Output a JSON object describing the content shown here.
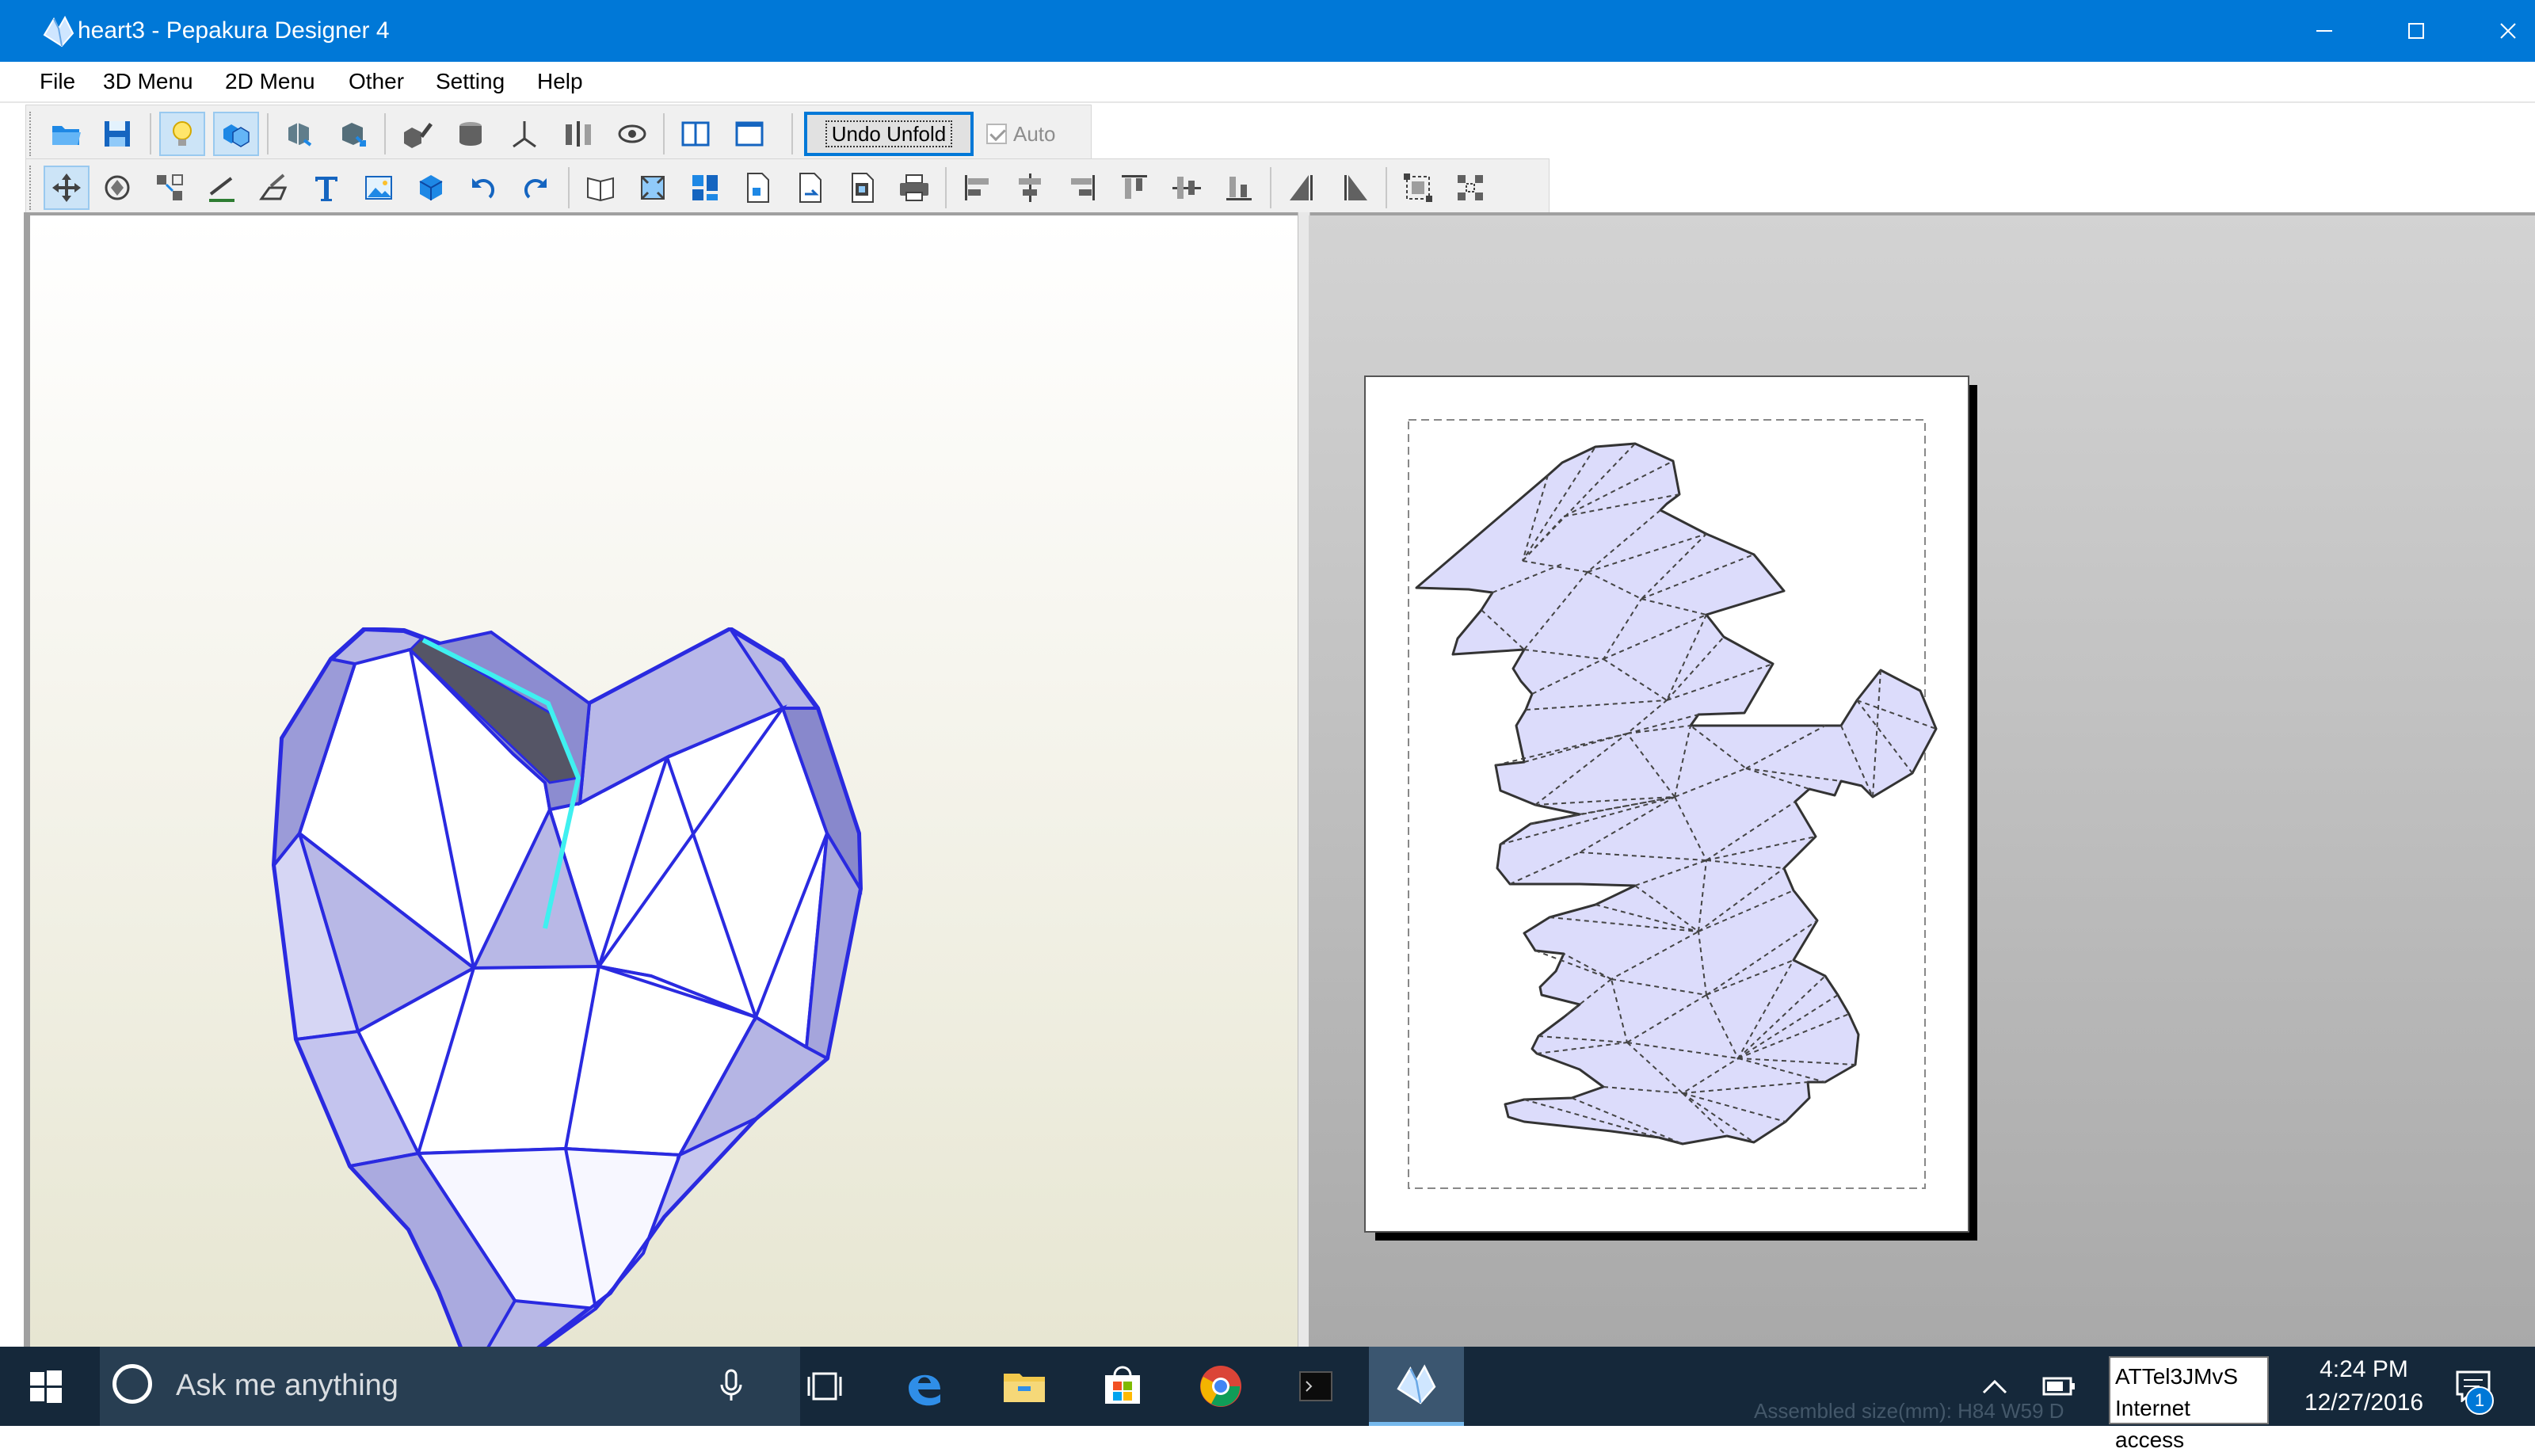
{
  "window": {
    "title": "heart3 - Pepakura Designer 4"
  },
  "menu": [
    "File",
    "3D Menu",
    "2D Menu",
    "Other",
    "Setting",
    "Help"
  ],
  "toolbar1": {
    "undo_unfold_label": "Undo Unfold",
    "auto_label": "Auto",
    "auto_checked": true
  },
  "status": {
    "assembled_size": "Assembled size(mm): H84 W59 D"
  },
  "taskbar": {
    "search_placeholder": "Ask me anything",
    "tooltip_lines": [
      "ATTel3JMvS",
      "Internet access"
    ],
    "time": "4:24 PM",
    "date": "12/27/2016",
    "notification_count": "1"
  },
  "colors": {
    "titlebar": "#0078d7",
    "model_edges": "#2a2ae0",
    "model_fill": "#c9c9f0",
    "parts_fill": "#dcdcfb",
    "taskbar": "#15283a"
  }
}
